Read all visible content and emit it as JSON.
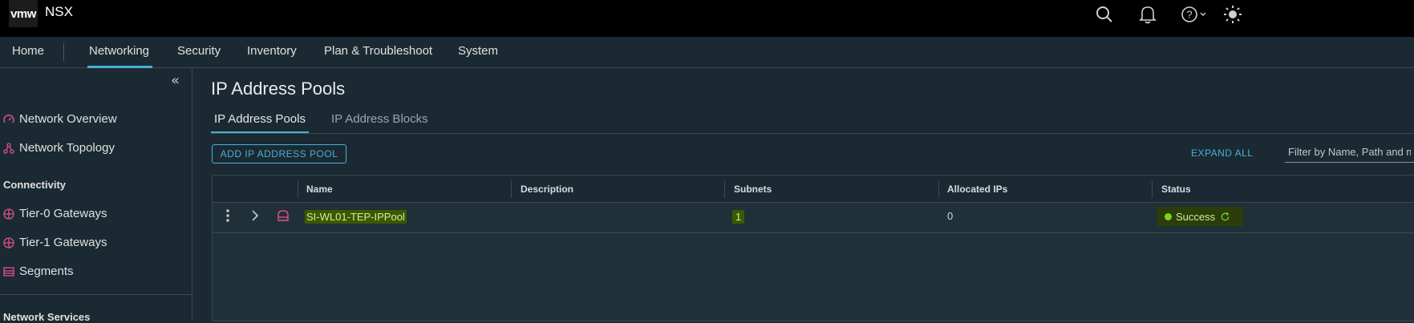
{
  "app": {
    "logo": "vmw",
    "title": "NSX"
  },
  "topbar": {
    "icons": [
      "search-icon",
      "bell-icon",
      "help-icon",
      "theme-icon"
    ]
  },
  "nav": {
    "items": [
      "Home",
      "Networking",
      "Security",
      "Inventory",
      "Plan & Troubleshoot",
      "System"
    ],
    "active": "Networking"
  },
  "sidebar": {
    "items_top": [
      "Network Overview",
      "Network Topology"
    ],
    "section_connectivity": "Connectivity",
    "connectivity_items": [
      "Tier-0 Gateways",
      "Tier-1 Gateways",
      "Segments"
    ],
    "section_services": "Network Services"
  },
  "page": {
    "title": "IP Address Pools",
    "tabs": [
      "IP Address Pools",
      "IP Address Blocks"
    ],
    "add_button": "ADD IP ADDRESS POOL",
    "expand_all": "EXPAND ALL",
    "filter_placeholder": "Filter by Name, Path and more"
  },
  "table": {
    "columns": [
      "Name",
      "Description",
      "Subnets",
      "Allocated IPs",
      "Status"
    ],
    "rows": [
      {
        "name": "SI-WL01-TEP-IPPool",
        "description": "",
        "subnets": "1",
        "allocated": "0",
        "status": "Success"
      }
    ]
  },
  "colors": {
    "accent": "#49afd9",
    "success": "#7ed321",
    "background": "#1b2a32",
    "topbar": "#000000"
  }
}
